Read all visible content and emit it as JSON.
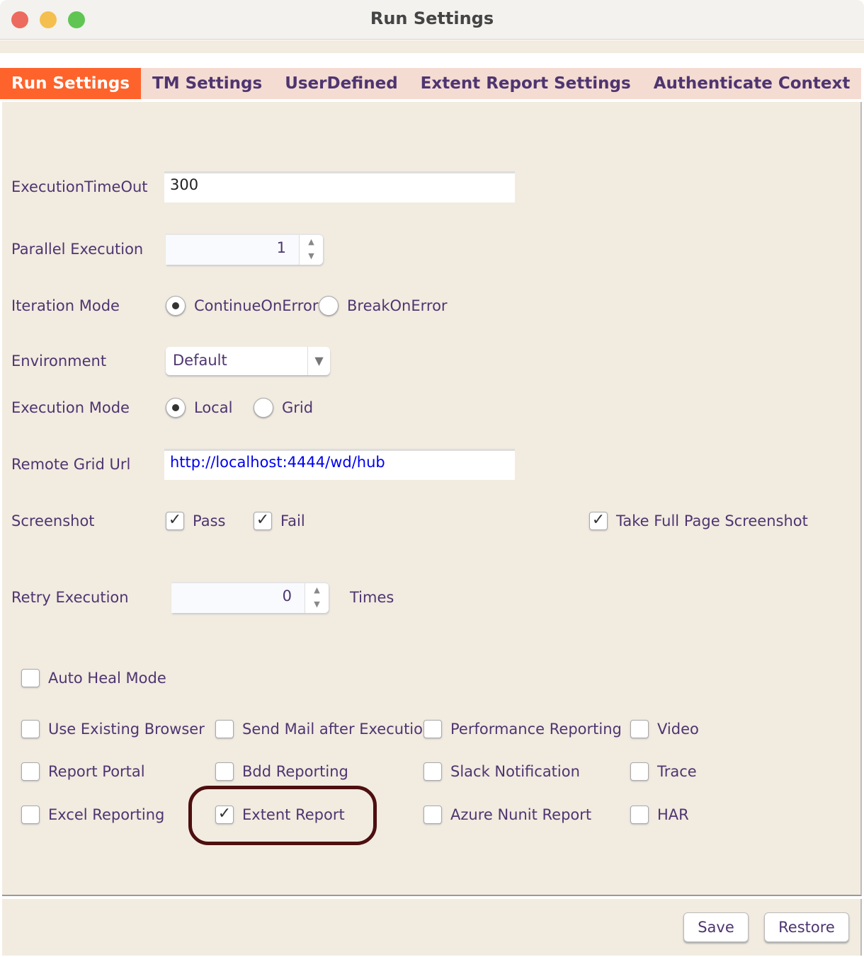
{
  "window": {
    "title": "Run Settings"
  },
  "tabs": [
    "Run Settings",
    "TM Settings",
    "UserDefined",
    "Extent Report Settings",
    "Authenticate Context"
  ],
  "form": {
    "execution_timeout": {
      "label": "ExecutionTimeOut",
      "value": "300"
    },
    "parallel_execution": {
      "label": "Parallel Execution",
      "value": "1"
    },
    "iteration_mode": {
      "label": "Iteration Mode",
      "options": [
        "ContinueOnError",
        "BreakOnError"
      ],
      "selected": "ContinueOnError"
    },
    "environment": {
      "label": "Environment",
      "value": "Default"
    },
    "execution_mode": {
      "label": "Execution Mode",
      "options": [
        "Local",
        "Grid"
      ],
      "selected": "Local"
    },
    "remote_grid_url": {
      "label": "Remote Grid Url",
      "value": "http://localhost:4444/wd/hub"
    },
    "screenshot": {
      "label": "Screenshot",
      "pass": "Pass",
      "fail": "Fail",
      "full_page": "Take Full Page Screenshot"
    },
    "retry": {
      "label": "Retry Execution",
      "value": "0",
      "suffix": "Times"
    },
    "auto_heal": "Auto Heal Mode"
  },
  "options": [
    {
      "label": "Use Existing Browser",
      "checked": false
    },
    {
      "label": "Send Mail after Execution",
      "checked": false
    },
    {
      "label": "Performance Reporting",
      "checked": false
    },
    {
      "label": "Video",
      "checked": false
    },
    {
      "label": "Report Portal",
      "checked": false
    },
    {
      "label": "Bdd Reporting",
      "checked": false
    },
    {
      "label": "Slack Notification",
      "checked": false
    },
    {
      "label": "Trace",
      "checked": false
    },
    {
      "label": "Excel Reporting",
      "checked": false
    },
    {
      "label": "Extent Report",
      "checked": true
    },
    {
      "label": "Azure Nunit Report",
      "checked": false
    },
    {
      "label": "HAR",
      "checked": false
    }
  ],
  "buttons": {
    "save": "Save",
    "restore": "Restore"
  },
  "colors": {
    "active_tab": "#fe632b",
    "tab_bar": "#f5dcd3",
    "panel": "#f2ebe0",
    "text": "#4e3570",
    "link": "#0000ee",
    "highlight": "#4d0f0f"
  }
}
